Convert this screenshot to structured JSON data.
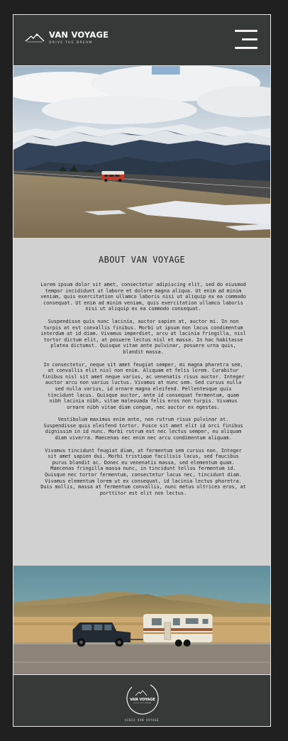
{
  "header": {
    "brand": "VAN VOYAGE",
    "tagline": "DRIVE THE DREAM",
    "logo_icon": "mountain-icon",
    "menu_icon": "hamburger-menu-icon"
  },
  "hero": {
    "alt": "Snowy mountain range with a red vintage van on the road"
  },
  "about": {
    "title": "ABOUT VAN VOYAGE",
    "paragraphs": [
      "Lorem ipsum dolor sit amet, consectetur adipiscing elit, sed do eiusmod tempor incididunt ut labore et dolore magna aliqua. Ut enim ad minim veniam, quis exercitation ullamco laboris nisi ut aliquip ex ea commodo consequat. Ut enim ad minim veniam, quis exercitation ullamco laboris nisi ut aliquip ex ea commodo consequat.",
      "Suspendisse quis nunc lacinia, auctor sapien at, auctor mi. In non turpis at est convallis finibus. Morbi ut ipsum non lacus condimentum interdum at id diam. Vivamus imperdiet, arcu at lacinia fringilla, nisl tortor dictum elit, at posuere lectus nisl et massa. In hac habitasse platea dictumst. Quisque vitae ante pulvinar, posuere urna quis, blandit massa.",
      "In consectetur, neque sit amet feugiat semper, mi magna pharetra sem, at convallis elit nisl non enim. Aliquam et felis lorem. Curabitur finibus nisl sit amet neque varius, ac venenatis risus auctor. Integer auctor arcu non varius luctus. Vivamus at nunc sem. Sed cursus nulla sed nulla varius, id ornare magna eleifend. Pellentesque quis tincidunt lacus. Quisque auctor, ante id consequat fermentum, quam nibh lacinia nibh, vitae malesuada felis eros non turpis. Vivamus ornare nibh vitae diam congue, nec auctor ex egestas.",
      "Vestibulum maximus enim ante, non rutrum risus pulvinar at. Suspendisse quis eleifend tortor. Fusce sit amet elit id orci finibus dignissim in id nunc. Morbi rutrum est nec lectus semper, eu aliquam diam viverra. Maecenas nec enim nec arcu condimentum aliquam.",
      "Vivamus tincidunt feugiat diam, at fermentum sem cursus non. Integer sit amet sapien dui. Morbi tristique facilisis lacus, sed faucibus purus blandit ac. Donec eu venenatis massa, sed elementum quam. Maecenas fringilla massa nunc, in tincidunt tellus fermentum id. Quisque nec tortor fermentum, consectetur lacus nec, tincidunt diam. Vivamus elementum lorem ut ex consequat, id lacinia lectus pharetra. Duis mollis, massa at fermentum convallis, nunc metus ultrices eros, at porttitor est elit non lectus."
    ]
  },
  "photo2": {
    "alt": "SUV towing a vintage camper trailer in the desert"
  },
  "footer": {
    "seal_brand": "VAN VOYAGE",
    "seal_tagline": "DRIVE THE DREAM",
    "copyright": "©2022 VAN VOYAGE"
  },
  "colors": {
    "header_bg": "#353a39",
    "page_bg": "#202020",
    "content_bg": "#d1d1d1"
  }
}
